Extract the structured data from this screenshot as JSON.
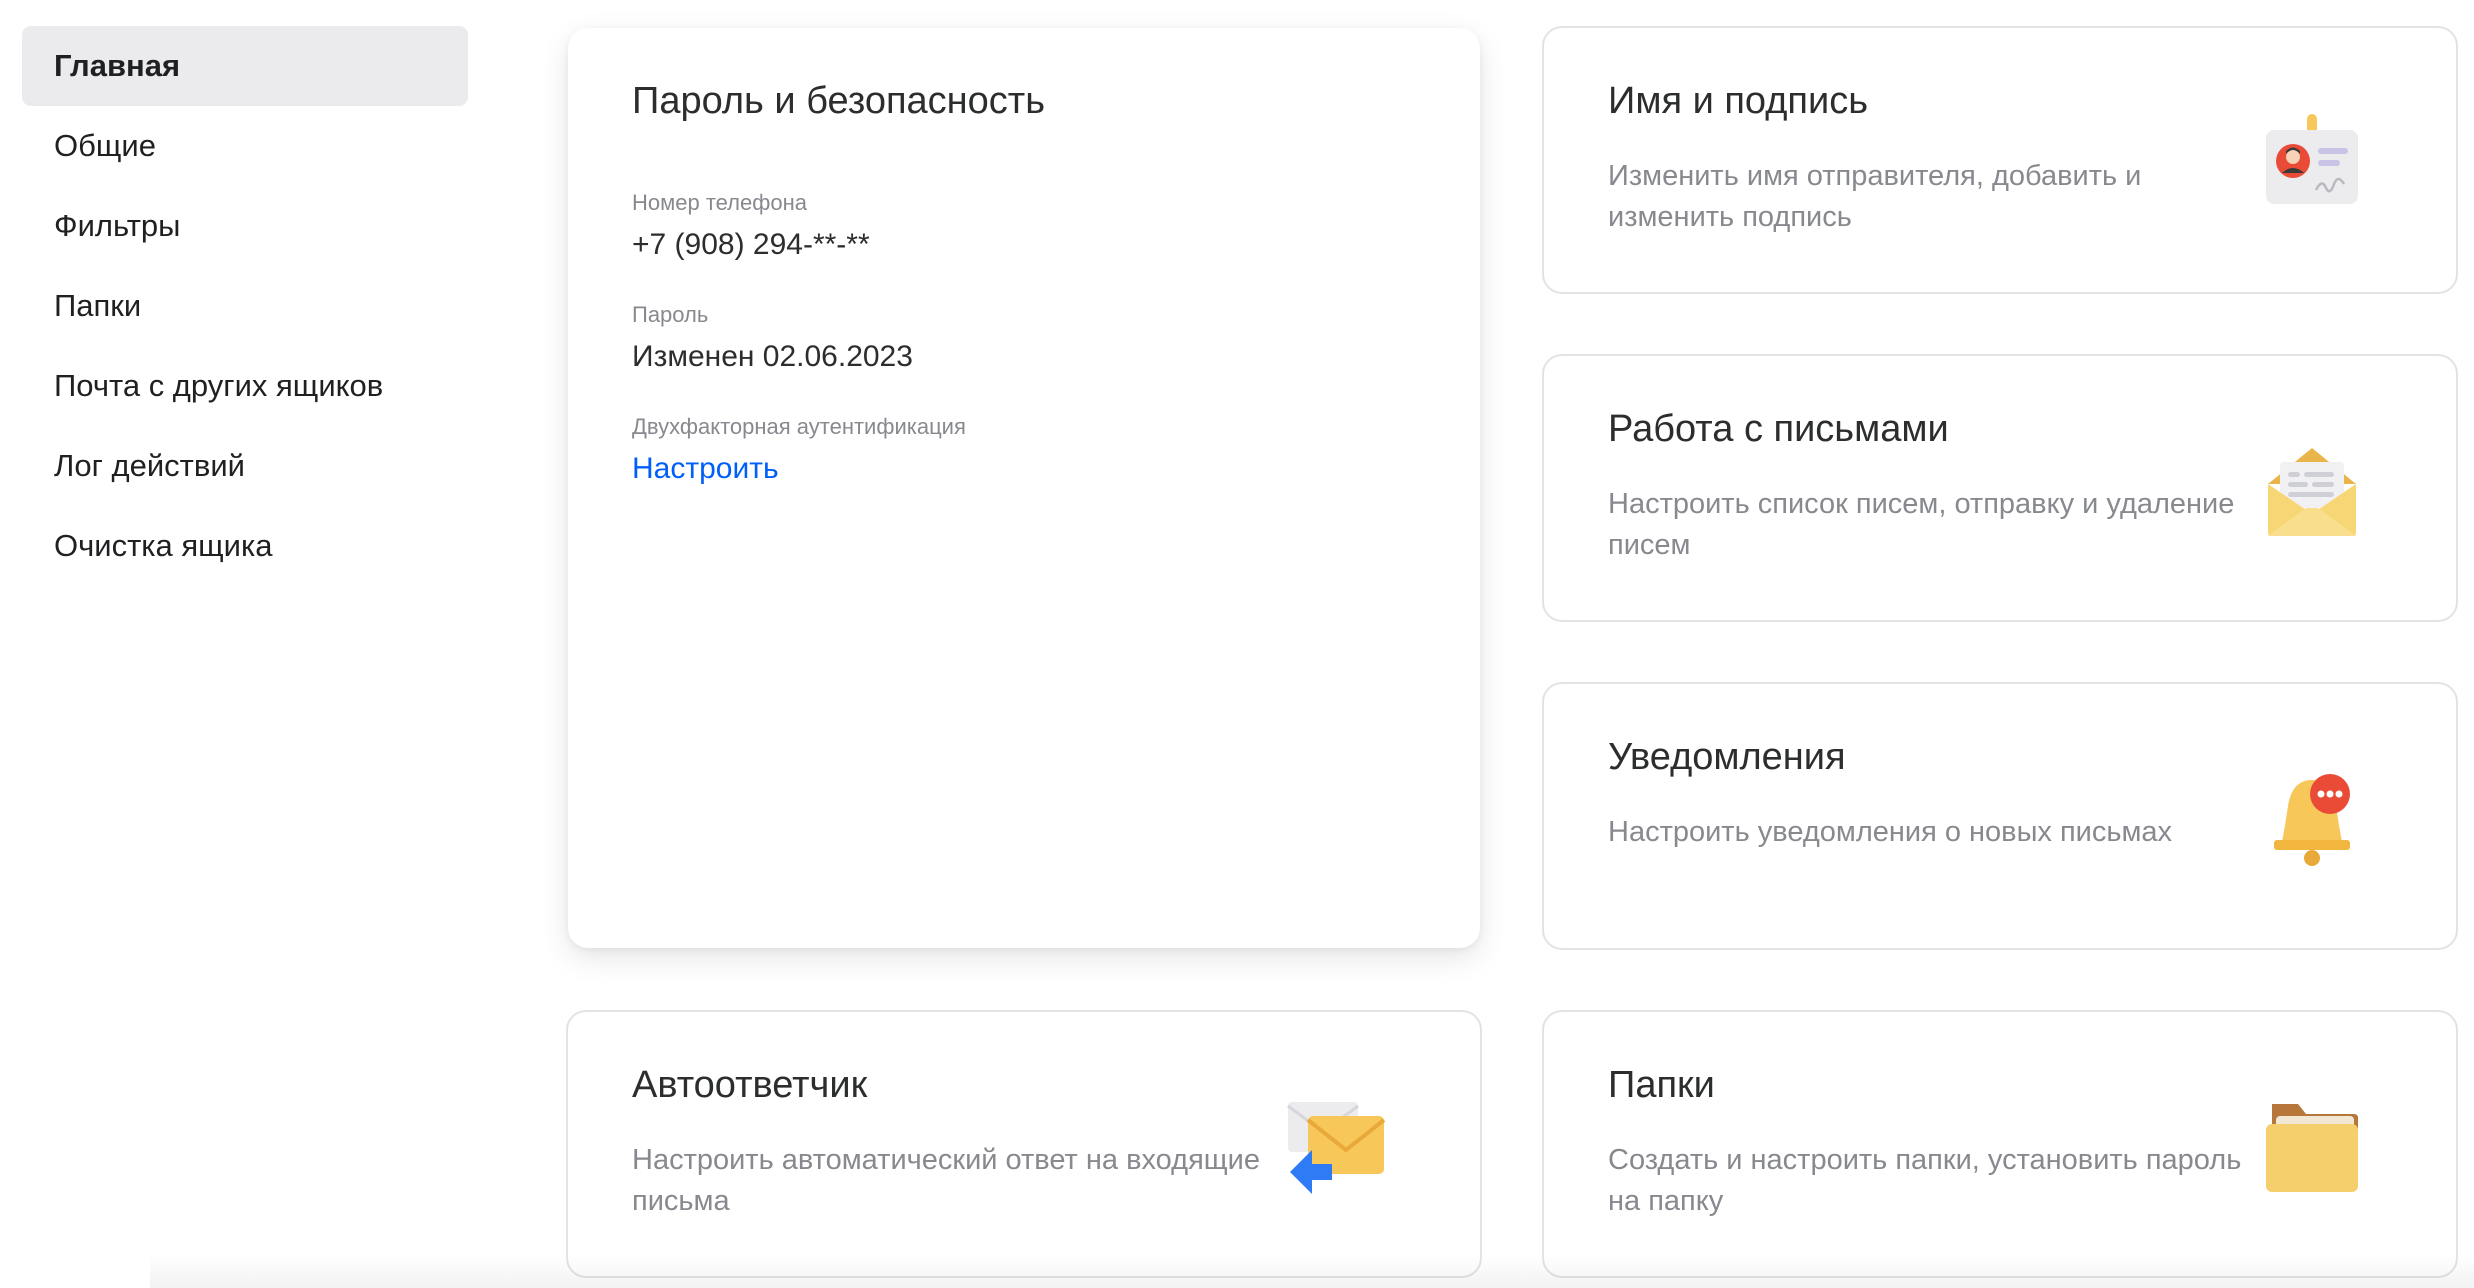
{
  "sidebar": {
    "items": [
      {
        "label": "Главная",
        "active": true
      },
      {
        "label": "Общие"
      },
      {
        "label": "Фильтры"
      },
      {
        "label": "Папки"
      },
      {
        "label": "Почта с других ящиков"
      },
      {
        "label": "Лог действий"
      },
      {
        "label": "Очистка ящика"
      }
    ]
  },
  "security": {
    "title": "Пароль и безопасность",
    "phone_label": "Номер телефона",
    "phone_value": "+7 (908) 294-**-**",
    "password_label": "Пароль",
    "password_value": "Изменен 02.06.2023",
    "twofa_label": "Двухфакторная аутентификация",
    "twofa_link": "Настроить"
  },
  "cards": {
    "name_signature": {
      "title": "Имя и подпись",
      "desc": "Изменить имя отправителя, добавить и изменить подпись",
      "icon": "id-badge-icon"
    },
    "letters": {
      "title": "Работа с письмами",
      "desc": "Настроить список писем, отправку и удаление писем",
      "icon": "open-envelope-icon"
    },
    "notifications": {
      "title": "Уведомления",
      "desc": "Настроить уведомления о новых письмах",
      "icon": "bell-icon"
    },
    "autoreply": {
      "title": "Автоответчик",
      "desc": "Настроить автоматический ответ на входящие письма",
      "icon": "autoreply-envelope-icon"
    },
    "folders": {
      "title": "Папки",
      "desc": "Создать и настроить папки, установить пароль на папку",
      "icon": "folder-icon"
    }
  },
  "colors": {
    "accent_link": "#005ff9",
    "active_nav_bg": "#ebebed",
    "muted_text": "#87898f",
    "icon_yellow": "#f7c75a",
    "icon_blue": "#2f7bf5",
    "badge_red": "#ea4b37"
  }
}
